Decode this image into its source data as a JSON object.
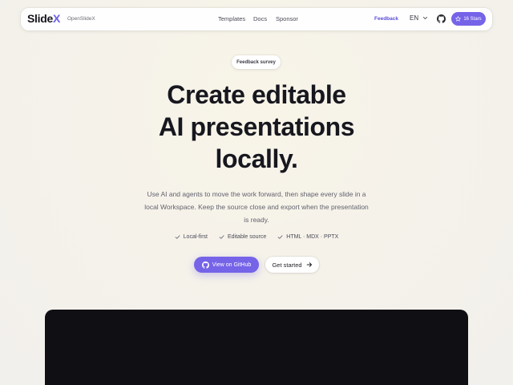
{
  "nav": {
    "brand_main": "Slide",
    "brand_x": "X",
    "brand_sub": "OpenSlideX",
    "links": [
      "Templates",
      "Docs",
      "Sponsor"
    ],
    "feedback": "Feedback",
    "language": "EN",
    "stars": "16 Stars"
  },
  "hero": {
    "pill": "Feedback survey",
    "headline": [
      "Create editable",
      "AI presentations",
      "locally."
    ],
    "description": "Use AI and agents to move the work forward, then shape every slide in a local Workspace. Keep the source close and export when the presentation is ready.",
    "features": [
      "Local-first",
      "Editable source",
      "HTML · MDX · PPTX"
    ],
    "primary_button": "View on GitHub",
    "secondary_button": "Get started"
  },
  "colors": {
    "accent": "#7563e8",
    "preview_bg": "#101014"
  }
}
